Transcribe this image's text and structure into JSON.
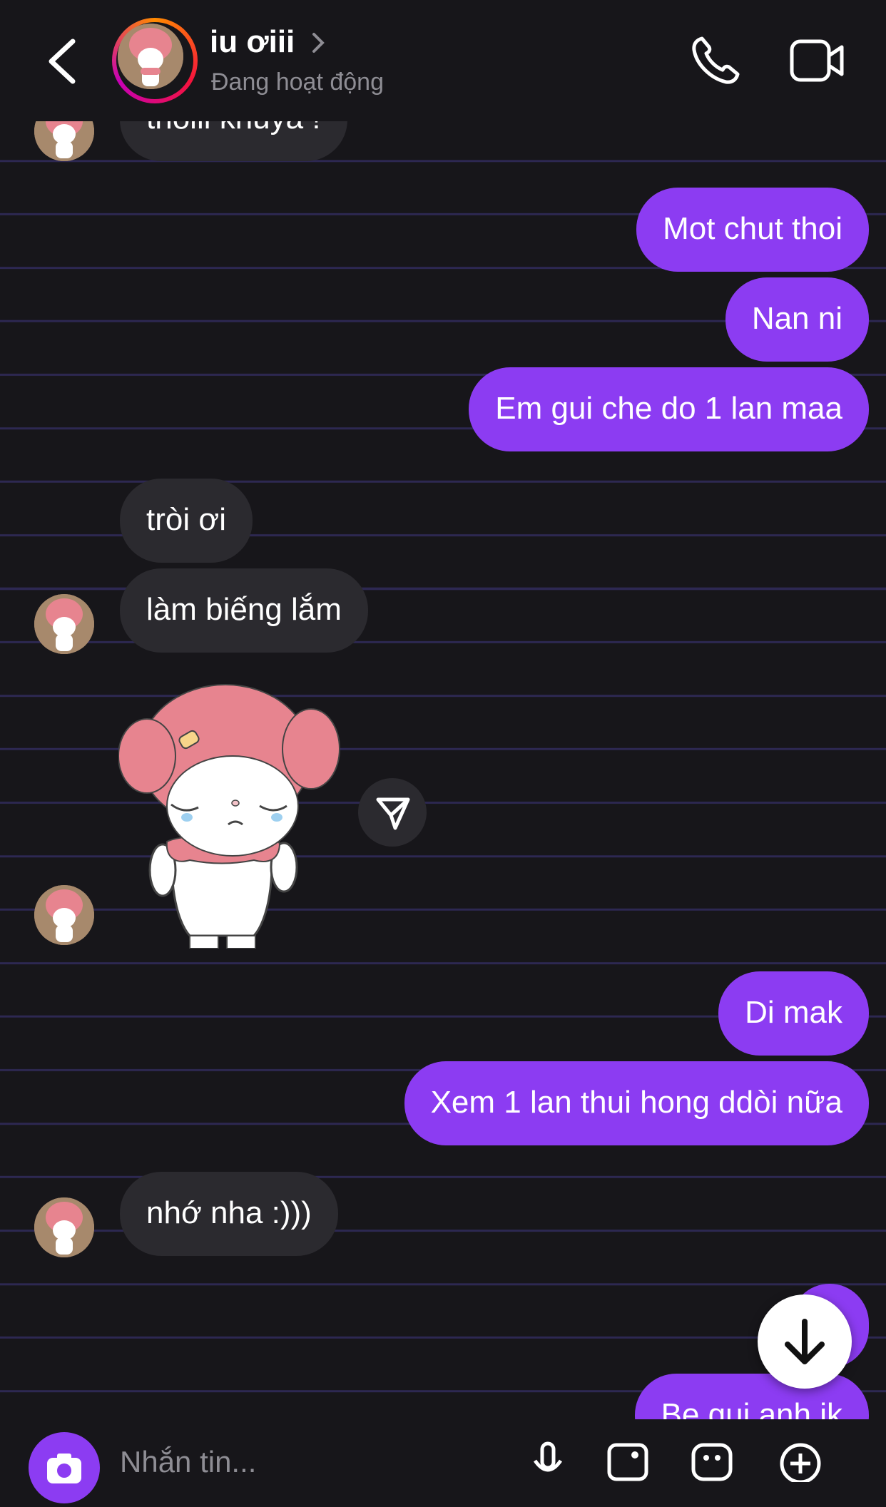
{
  "header": {
    "contact_name": "iu ơiii",
    "status": "Đang hoạt động"
  },
  "messages": {
    "partial_top": "thôiii khuya !",
    "m1": "Mot chut thoi",
    "m2": "Nan ni",
    "m3": "Em gui che do 1 lan maa",
    "m4": "tròi ơi",
    "m5": "làm biếng lắm",
    "m6": "Di mak",
    "m7": "Xem 1 lan thui hong ddòi nữa",
    "m8": "nhớ nha :)))",
    "partial_bottom": "Be gui anh ik"
  },
  "composer": {
    "placeholder": "Nhắn tin..."
  },
  "colors": {
    "sent_bubble": "#8c3cf2",
    "received_bubble": "#2b2a2f",
    "background": "#17161a",
    "line": "#2d2852"
  },
  "icons": [
    "back-icon",
    "chevron-right-icon",
    "phone-icon",
    "video-icon",
    "share-icon",
    "arrow-down-icon",
    "camera-icon",
    "mic-icon",
    "gallery-icon",
    "sticker-icon",
    "plus-icon"
  ]
}
